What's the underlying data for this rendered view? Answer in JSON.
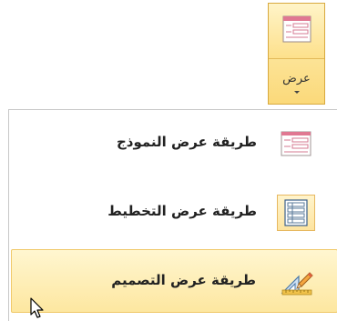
{
  "view_button": {
    "label": "عرض",
    "icon": "form-view-icon"
  },
  "menu": {
    "items": [
      {
        "label": "طريقة عرض النموذج",
        "icon": "form-view-icon",
        "state": "normal"
      },
      {
        "label": "طريقة عرض التخطيط",
        "icon": "layout-view-icon",
        "state": "selected"
      },
      {
        "label": "طريقة عرض التصميم",
        "icon": "design-view-icon",
        "state": "hovered"
      }
    ]
  },
  "colors": {
    "highlight_top": "#fff6d0",
    "highlight_bottom": "#fde7a0",
    "highlight_border": "#f0c96a",
    "form_icon": "#d86a8a",
    "layout_icon": "#3a5f8a"
  }
}
